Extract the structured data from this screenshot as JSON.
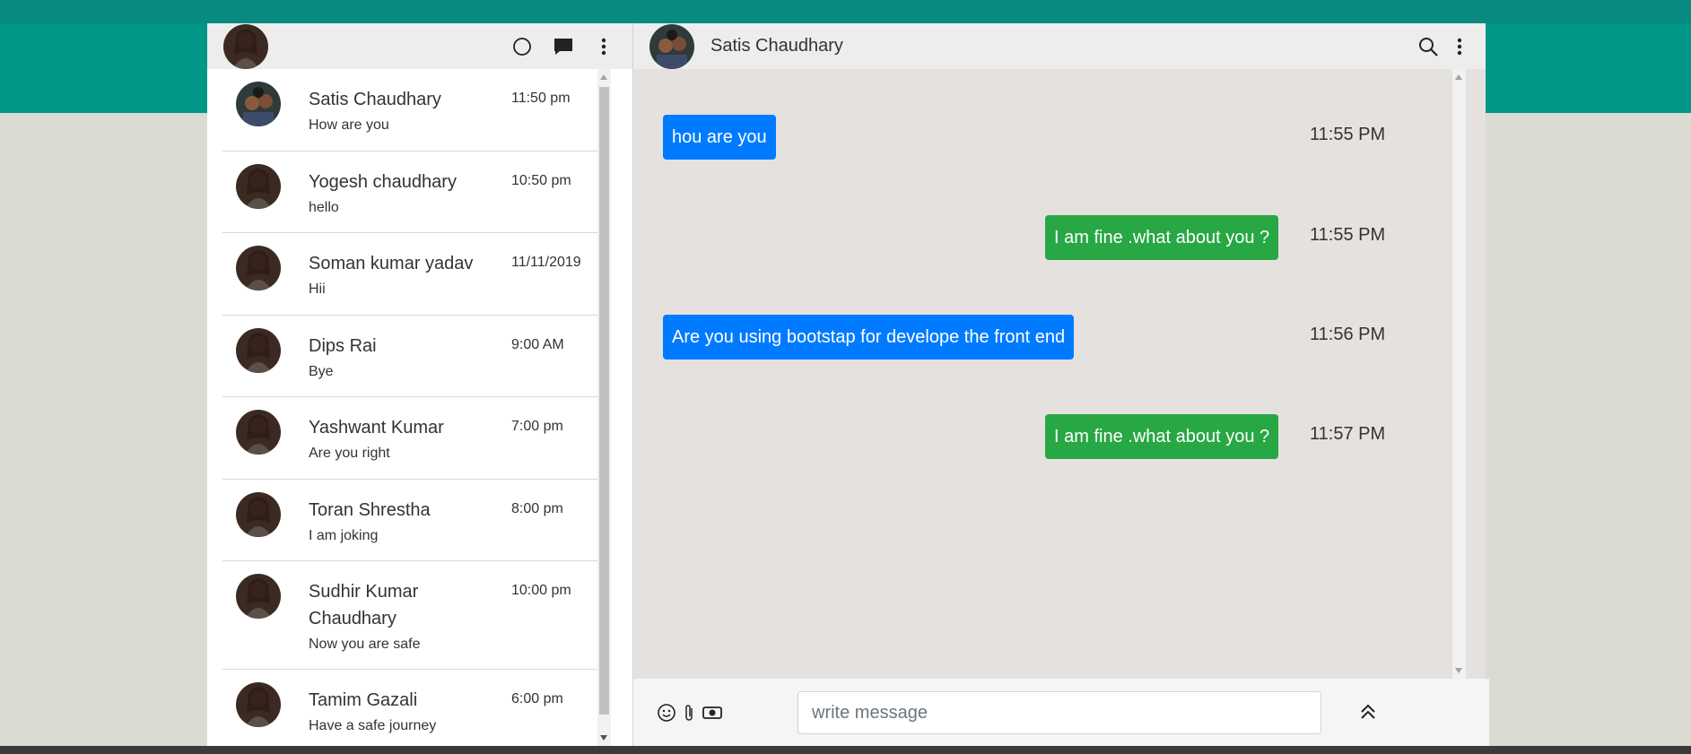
{
  "left_header": {
    "icons": [
      "user-avatar",
      "status-icon",
      "new-chat-icon",
      "menu-icon"
    ]
  },
  "chats": [
    {
      "name": "Satis Chaudhary",
      "time": "11:50 pm",
      "message": "How are you"
    },
    {
      "name": "Yogesh chaudhary",
      "time": "10:50 pm",
      "message": "hello"
    },
    {
      "name": "Soman kumar yadav",
      "time": "11/11/2019",
      "message": "Hii"
    },
    {
      "name": "Dips Rai",
      "time": "9:00 AM",
      "message": "Bye"
    },
    {
      "name": "Yashwant Kumar",
      "time": "7:00 pm",
      "message": "Are you right"
    },
    {
      "name": "Toran Shrestha",
      "time": "8:00 pm",
      "message": "I am joking"
    },
    {
      "name": "Sudhir Kumar Chaudhary",
      "time": "10:00 pm",
      "message": "Now you are safe"
    },
    {
      "name": "Tamim Gazali",
      "time": "6:00 pm",
      "message": "Have a safe journey"
    }
  ],
  "conversation": {
    "contact_name": "Satis Chaudhary",
    "messages": [
      {
        "text": "hou are you",
        "time": "11:55 PM",
        "direction": "in"
      },
      {
        "text": "I am fine .what about you ?",
        "time": "11:55 PM",
        "direction": "out"
      },
      {
        "text": "Are you using bootstap for develope the front end",
        "time": "11:56 PM",
        "direction": "in"
      },
      {
        "text": "I am fine .what about you ?",
        "time": "11:57 PM",
        "direction": "out"
      }
    ]
  },
  "composer": {
    "placeholder": "write message",
    "icons": [
      "emoji-icon",
      "attachment-icon",
      "camera-icon",
      "send-icon"
    ]
  },
  "colors": {
    "brand": "#009688",
    "incoming": "#007bff",
    "outgoing": "#28a745"
  }
}
